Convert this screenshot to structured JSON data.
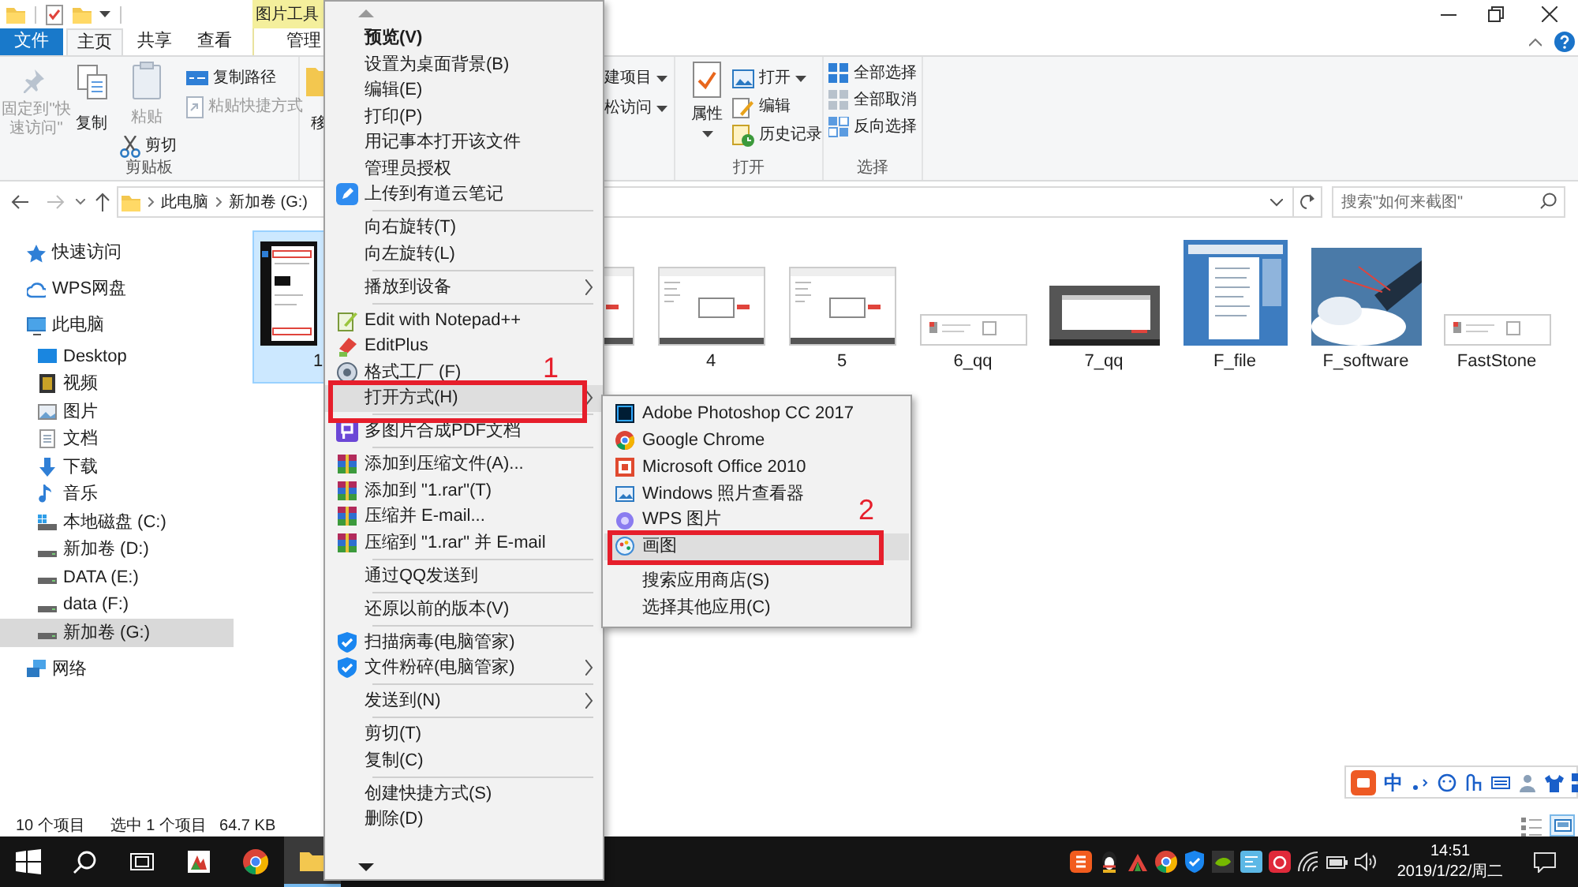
{
  "title_bar": {
    "context_tab": "图片工具"
  },
  "ribbon_tabs": [
    {
      "label": "文件",
      "kind": "file",
      "selected": false
    },
    {
      "label": "主页",
      "kind": "tab",
      "selected": true
    },
    {
      "label": "共享",
      "kind": "tab",
      "selected": false
    },
    {
      "label": "查看",
      "kind": "tab",
      "selected": false
    },
    {
      "label": "管理",
      "kind": "context",
      "selected": false
    }
  ],
  "ribbon": {
    "clipboard": {
      "label": "剪贴板",
      "pin": {
        "label": "固定到\"快速访问\"",
        "disabled": true
      },
      "copy": {
        "label": "复制",
        "disabled": false
      },
      "paste": {
        "label": "粘贴",
        "disabled": true
      },
      "cut": {
        "label": "剪切",
        "disabled": false
      },
      "copy_path": {
        "label": "复制路径",
        "disabled": false
      },
      "paste_shortcut": {
        "label": "粘贴快捷方式",
        "disabled": true
      }
    },
    "organize": {
      "move": "移"
    },
    "new": {
      "new_item": "建项目",
      "easy_access": "松访问"
    },
    "open": {
      "label": "打开",
      "properties": "属性",
      "open": "打开",
      "edit": "编辑",
      "history": "历史记录"
    },
    "select": {
      "label": "选择",
      "select_all": "全部选择",
      "select_none": "全部取消",
      "invert": "反向选择"
    }
  },
  "address": {
    "path": [
      "此电脑",
      "新加卷 (G:)"
    ],
    "search_placeholder": "搜索\"如何来截图\""
  },
  "nav": [
    {
      "label": "快速访问",
      "kind": "quick",
      "selected": false
    },
    {
      "label": "WPS网盘",
      "kind": "cloud",
      "selected": false
    },
    {
      "label": "此电脑",
      "kind": "pc",
      "selected": false,
      "children": [
        {
          "label": "Desktop",
          "kind": "desktop",
          "selected": false
        },
        {
          "label": "视频",
          "kind": "video",
          "selected": false
        },
        {
          "label": "图片",
          "kind": "pictures",
          "selected": false
        },
        {
          "label": "文档",
          "kind": "documents",
          "selected": false
        },
        {
          "label": "下载",
          "kind": "downloads",
          "selected": false
        },
        {
          "label": "音乐",
          "kind": "music",
          "selected": false
        },
        {
          "label": "本地磁盘 (C:)",
          "kind": "system_drive",
          "selected": false
        },
        {
          "label": "新加卷 (D:)",
          "kind": "drive",
          "selected": false
        },
        {
          "label": "DATA (E:)",
          "kind": "drive",
          "selected": false
        },
        {
          "label": "data (F:)",
          "kind": "drive",
          "selected": false
        },
        {
          "label": "新加卷 (G:)",
          "kind": "drive",
          "selected": true
        }
      ]
    },
    {
      "label": "网络",
      "kind": "network",
      "selected": false
    }
  ],
  "files": [
    {
      "name": "1",
      "kind": "tall",
      "selected": true
    },
    {
      "kind": "wide",
      "selected": false
    },
    {
      "name": "4",
      "kind": "wide",
      "selected": false
    },
    {
      "name": "5",
      "kind": "wide",
      "selected": false
    },
    {
      "name": "6_qq",
      "kind": "strip",
      "selected": false
    },
    {
      "name": "7_qq",
      "kind": "dark",
      "selected": false
    },
    {
      "name": "F_file",
      "kind": "blue_panel",
      "selected": false
    },
    {
      "name": "F_software",
      "kind": "sky",
      "selected": false
    },
    {
      "name": "FastStone",
      "kind": "strip",
      "selected": false
    }
  ],
  "status_bar": {
    "count": "10 个项目",
    "selection": "选中 1 个项目",
    "size": "64.7 KB"
  },
  "context_menu": [
    {
      "label": "预览(V)",
      "kind": "default",
      "has_submenu": false,
      "selected": false,
      "separator_before": false
    },
    {
      "label": "设置为桌面背景(B)",
      "kind": "plain",
      "has_submenu": false,
      "selected": false,
      "separator_before": false
    },
    {
      "label": "编辑(E)",
      "kind": "plain",
      "has_submenu": false,
      "selected": false,
      "separator_before": false
    },
    {
      "label": "打印(P)",
      "kind": "plain",
      "has_submenu": false,
      "selected": false,
      "separator_before": false
    },
    {
      "label": "用记事本打开该文件",
      "kind": "plain",
      "has_submenu": false,
      "selected": false,
      "separator_before": false
    },
    {
      "label": "管理员授权",
      "kind": "plain",
      "has_submenu": false,
      "selected": false,
      "separator_before": false
    },
    {
      "label": "上传到有道云笔记",
      "kind": "youdao",
      "has_submenu": false,
      "selected": false,
      "separator_before": false
    },
    {
      "label": "向右旋转(T)",
      "kind": "plain",
      "has_submenu": false,
      "selected": false,
      "separator_before": true
    },
    {
      "label": "向左旋转(L)",
      "kind": "plain",
      "has_submenu": false,
      "selected": false,
      "separator_before": false
    },
    {
      "label": "播放到设备",
      "kind": "plain",
      "has_submenu": true,
      "selected": false,
      "separator_before": true
    },
    {
      "label": "Edit with Notepad++",
      "kind": "notepadpp",
      "has_submenu": false,
      "selected": false,
      "separator_before": true
    },
    {
      "label": "EditPlus",
      "kind": "editplus",
      "has_submenu": false,
      "selected": false,
      "separator_before": false
    },
    {
      "label": "格式工厂 (F)",
      "kind": "formatfactory",
      "has_submenu": false,
      "selected": false,
      "separator_before": false
    },
    {
      "label": "打开方式(H)",
      "kind": "plain",
      "has_submenu": true,
      "selected": true,
      "separator_before": false,
      "callout": "1"
    },
    {
      "label": "多图片合成PDF文档",
      "kind": "pdf",
      "has_submenu": false,
      "selected": false,
      "separator_before": true
    },
    {
      "label": "添加到压缩文件(A)...",
      "kind": "winrar",
      "has_submenu": false,
      "selected": false,
      "separator_before": true
    },
    {
      "label": "添加到 \"1.rar\"(T)",
      "kind": "winrar",
      "has_submenu": false,
      "selected": false,
      "separator_before": false
    },
    {
      "label": "压缩并 E-mail...",
      "kind": "winrar",
      "has_submenu": false,
      "selected": false,
      "separator_before": false
    },
    {
      "label": "压缩到 \"1.rar\" 并 E-mail",
      "kind": "winrar",
      "has_submenu": false,
      "selected": false,
      "separator_before": false
    },
    {
      "label": "通过QQ发送到",
      "kind": "plain",
      "has_submenu": false,
      "selected": false,
      "separator_before": true
    },
    {
      "label": "还原以前的版本(V)",
      "kind": "plain",
      "has_submenu": false,
      "selected": false,
      "separator_before": true
    },
    {
      "label": "扫描病毒(电脑管家)",
      "kind": "guard",
      "has_submenu": false,
      "selected": false,
      "separator_before": true
    },
    {
      "label": "文件粉碎(电脑管家)",
      "kind": "guard",
      "has_submenu": true,
      "selected": false,
      "separator_before": false
    },
    {
      "label": "发送到(N)",
      "kind": "plain",
      "has_submenu": true,
      "selected": false,
      "separator_before": true
    },
    {
      "label": "剪切(T)",
      "kind": "plain",
      "has_submenu": false,
      "selected": false,
      "separator_before": true
    },
    {
      "label": "复制(C)",
      "kind": "plain",
      "has_submenu": false,
      "selected": false,
      "separator_before": false
    },
    {
      "label": "创建快捷方式(S)",
      "kind": "plain",
      "has_submenu": false,
      "selected": false,
      "separator_before": true
    },
    {
      "label": "删除(D)",
      "kind": "plain",
      "has_submenu": false,
      "selected": false,
      "separator_before": false
    }
  ],
  "open_with_menu": [
    {
      "label": "Adobe Photoshop CC 2017",
      "kind": "photoshop",
      "selected": false,
      "separator_before": false
    },
    {
      "label": "Google Chrome",
      "kind": "chrome",
      "selected": false,
      "separator_before": false
    },
    {
      "label": "Microsoft Office 2010",
      "kind": "office",
      "selected": false,
      "separator_before": false
    },
    {
      "label": "Windows 照片查看器",
      "kind": "photoviewer",
      "selected": false,
      "separator_before": false
    },
    {
      "label": "WPS 图片",
      "kind": "wps",
      "selected": false,
      "separator_before": false
    },
    {
      "label": "画图",
      "kind": "paint",
      "selected": true,
      "separator_before": false,
      "callout": "2"
    },
    {
      "label": "搜索应用商店(S)",
      "kind": "plain",
      "selected": false,
      "separator_before": true
    },
    {
      "label": "选择其他应用(C)",
      "kind": "plain",
      "selected": false,
      "separator_before": false
    }
  ],
  "ime_toolbar": {
    "mode": "中"
  },
  "taskbar": {
    "time": "14:51",
    "date": "2019/1/22/周二"
  }
}
